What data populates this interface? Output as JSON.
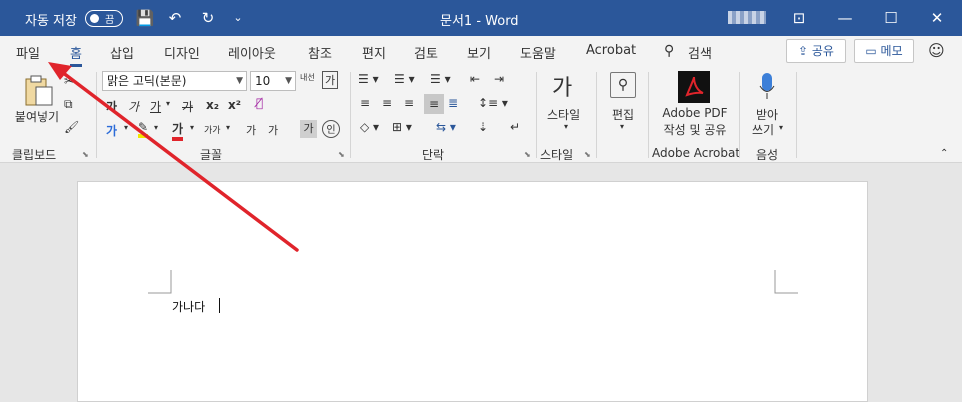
{
  "titlebar": {
    "autosave_label": "자동 저장",
    "toggle_state": "끔",
    "doc_title": "문서1 - Word",
    "qat": {
      "save": "💾",
      "undo": "↶",
      "redo": "↻",
      "more": "⌄"
    },
    "win": {
      "ribbon": "⊡",
      "minimize": "—",
      "restore": "☐",
      "close": "✕"
    }
  },
  "tabs": [
    "파일",
    "홈",
    "삽입",
    "디자인",
    "레이아웃",
    "참조",
    "편지",
    "검토",
    "보기",
    "도움말",
    "Acrobat",
    "검색"
  ],
  "tabs_right": {
    "share": "공유",
    "memo": "메모"
  },
  "ribbon": {
    "clipboard": {
      "paste": "붙여넣기",
      "label": "클립보드"
    },
    "font": {
      "name": "맑은 고딕(본문)",
      "size": "10",
      "grow": "내선",
      "label": "글꼴",
      "row2": [
        "가",
        "가",
        "가",
        "가",
        "x₂",
        "x²"
      ],
      "row3": [
        "가",
        "가",
        "가가",
        "가",
        "가",
        "가",
        "인"
      ]
    },
    "paragraph": {
      "label": "단락"
    },
    "styles": {
      "name": "스타일",
      "label": "스타일",
      "glyph": "가"
    },
    "edit": {
      "name": "편집"
    },
    "adobe": {
      "line1": "Adobe PDF",
      "line2": "작성 및 공유",
      "label": "Adobe Acrobat"
    },
    "voice": {
      "line1": "받아",
      "line2": "쓰기",
      "label": "음성"
    }
  },
  "document": {
    "text": "가나다"
  },
  "colors": {
    "brand": "#2b579a",
    "arrow": "#e0242b"
  }
}
